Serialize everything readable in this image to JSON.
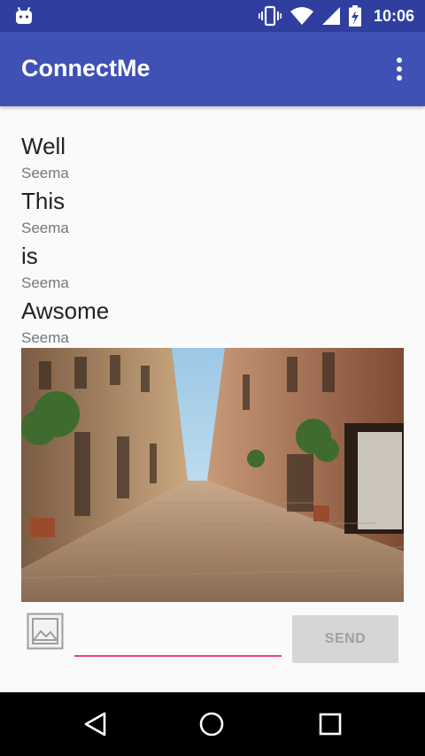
{
  "status_bar": {
    "time": "10:06",
    "icons": [
      "android-icon",
      "vibrate-icon",
      "wifi-icon",
      "signal-icon",
      "battery-charging-icon"
    ]
  },
  "app_bar": {
    "title": "ConnectMe",
    "overflow_icon": "more-vert-icon"
  },
  "messages": [
    {
      "text": "Well",
      "author": "Seema"
    },
    {
      "text": "This",
      "author": "Seema"
    },
    {
      "text": "is",
      "author": "Seema"
    },
    {
      "text": "Awsome",
      "author": "Seema"
    }
  ],
  "photo": {
    "subject": "street-photo"
  },
  "composer": {
    "gallery_icon": "image-icon",
    "input_value": "",
    "input_placeholder": "",
    "send_label": "SEND"
  },
  "nav_bar": {
    "icons": [
      "back-icon",
      "home-icon",
      "recents-icon"
    ]
  },
  "colors": {
    "status_bar": "#303f9f",
    "app_bar": "#3f51b5",
    "input_underline": "#e94675",
    "send_button_bg": "#d6d6d6"
  }
}
